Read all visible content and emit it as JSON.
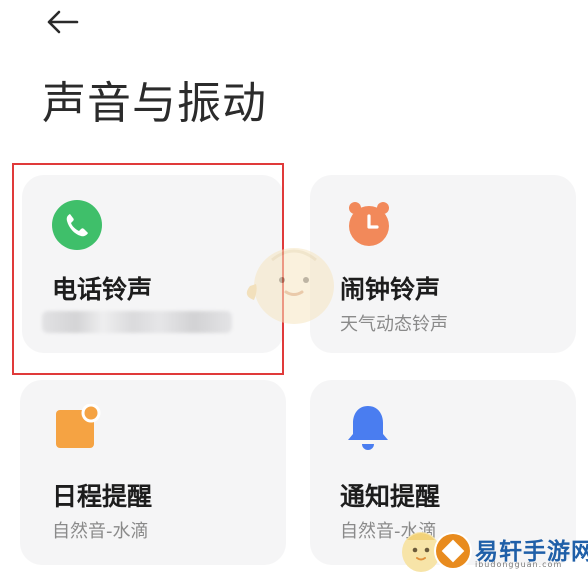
{
  "header": {
    "back_icon": "arrow-left-icon",
    "title": "声音与振动"
  },
  "cards": {
    "phone": {
      "title": "电话铃声",
      "subtitle": "",
      "icon": "phone-icon",
      "icon_color": "#3fbf6a"
    },
    "alarm": {
      "title": "闹钟铃声",
      "subtitle": "天气动态铃声",
      "icon": "alarm-clock-icon",
      "icon_color": "#f2895a"
    },
    "calendar": {
      "title": "日程提醒",
      "subtitle": "自然音-水滴",
      "icon": "calendar-icon",
      "icon_color": "#f5a343"
    },
    "notification": {
      "title": "通知提醒",
      "subtitle": "自然音-水滴",
      "icon": "bell-icon",
      "icon_color": "#4a7df0"
    }
  },
  "watermark": {
    "brand": "易轩手游网",
    "domain": "ibudongguan.com"
  }
}
